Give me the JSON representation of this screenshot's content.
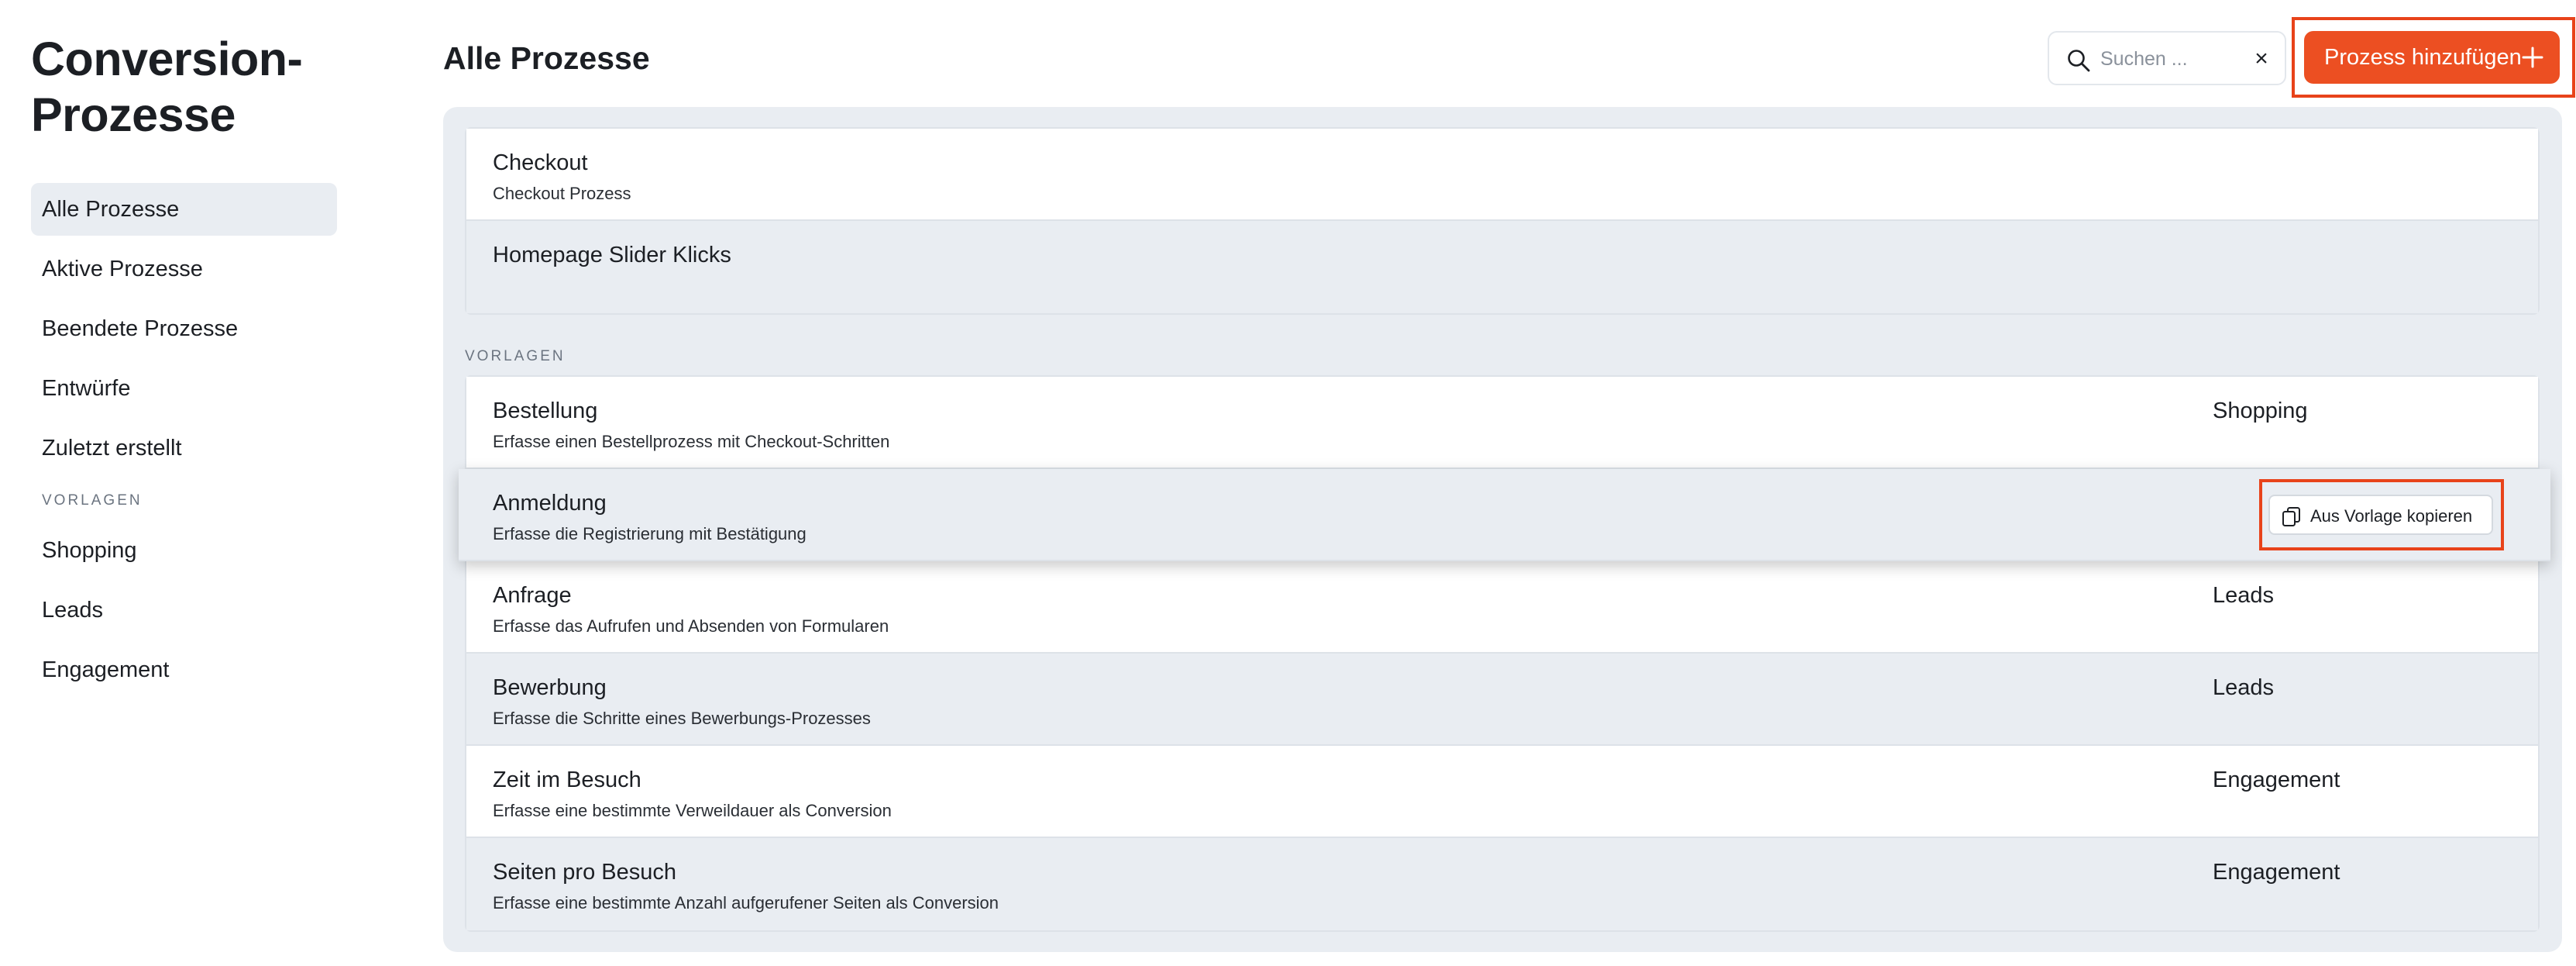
{
  "sidebar": {
    "title": "Conversion-\nProzesse",
    "nav": [
      {
        "label": "Alle Prozesse",
        "active": true
      },
      {
        "label": "Aktive Prozesse",
        "active": false
      },
      {
        "label": "Beendete Prozesse",
        "active": false
      },
      {
        "label": "Entwürfe",
        "active": false
      },
      {
        "label": "Zuletzt erstellt",
        "active": false
      }
    ],
    "templates_section": "VORLAGEN",
    "templates": [
      {
        "label": "Shopping"
      },
      {
        "label": "Leads"
      },
      {
        "label": "Engagement"
      }
    ]
  },
  "header": {
    "title": "Alle Prozesse",
    "search_placeholder": "Suchen ...",
    "add_button": "Prozess hinzufügen"
  },
  "processes": [
    {
      "title": "Checkout",
      "description": "Checkout Prozess"
    },
    {
      "title": "Homepage Slider Klicks",
      "description": ""
    }
  ],
  "templates_section": "VORLAGEN",
  "templates": [
    {
      "title": "Bestellung",
      "description": "Erfasse einen Bestellprozess mit Checkout-Schritten",
      "category": "Shopping"
    },
    {
      "title": "Anmeldung",
      "description": "Erfasse die Registrierung mit Bestätigung",
      "category": ""
    },
    {
      "title": "Anfrage",
      "description": "Erfasse das Aufrufen und Absenden von Formularen",
      "category": "Leads"
    },
    {
      "title": "Bewerbung",
      "description": "Erfasse die Schritte eines Bewerbungs-Prozesses",
      "category": "Leads"
    },
    {
      "title": "Zeit im Besuch",
      "description": "Erfasse eine bestimmte Verweildauer als Conversion",
      "category": "Engagement"
    },
    {
      "title": "Seiten pro Besuch",
      "description": "Erfasse eine bestimmte Anzahl aufgerufener Seiten als Conversion",
      "category": "Engagement"
    }
  ],
  "copy_button": "Aus Vorlage kopieren",
  "colors": {
    "accent": "#ec4f22",
    "highlight_border": "#e8431a",
    "panel_bg": "#e9edf2"
  }
}
